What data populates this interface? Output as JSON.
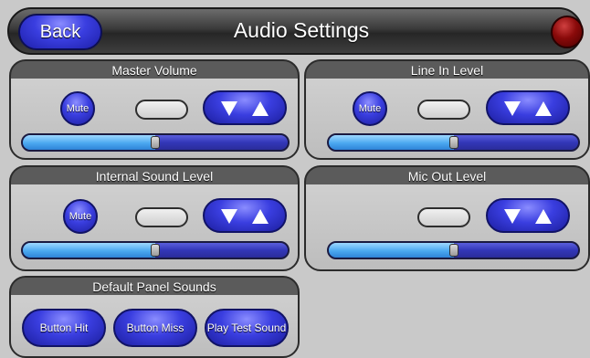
{
  "header": {
    "back_label": "Back",
    "title": "Audio Settings"
  },
  "colors": {
    "accent": "#3a3ee0",
    "panel_header": "#5b5b5b",
    "status_led": "#8a0a0a",
    "slider_fill": "#4aa8f0"
  },
  "panels": {
    "master_volume": {
      "title": "Master Volume",
      "mute_label": "Mute",
      "level_percent": 50
    },
    "line_in_level": {
      "title": "Line In Level",
      "mute_label": "Mute",
      "level_percent": 50
    },
    "internal_sound_level": {
      "title": "Internal Sound Level",
      "mute_label": "Mute",
      "level_percent": 50
    },
    "mic_out_level": {
      "title": "Mic Out Level",
      "level_percent": 50
    },
    "default_panel_sounds": {
      "title": "Default Panel Sounds",
      "buttons": [
        "Button Hit",
        "Button Miss",
        "Play Test Sound"
      ]
    }
  },
  "icons": {
    "updown": "down-up-arrows-icon",
    "led": "status-led-icon"
  }
}
